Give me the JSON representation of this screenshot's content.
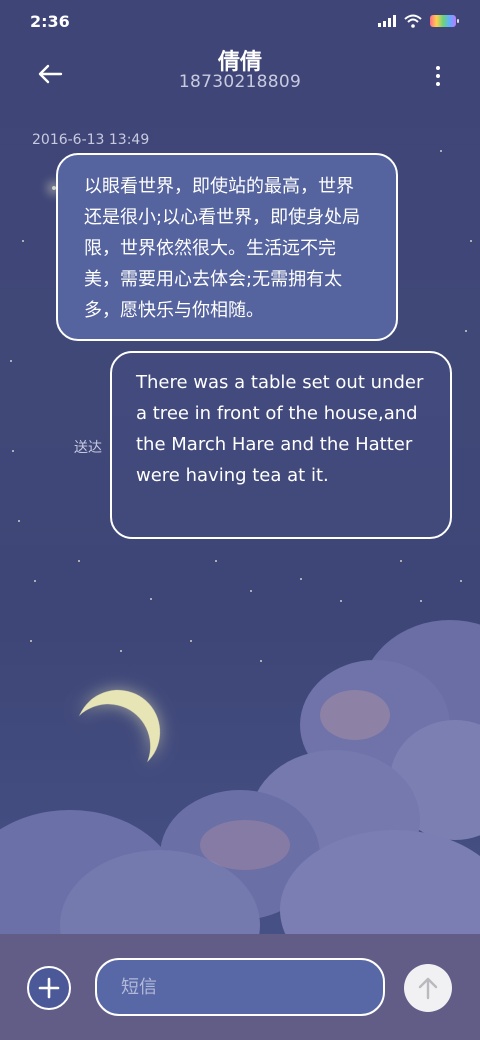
{
  "status_bar": {
    "time": "2:36",
    "icons": [
      "signal-icon",
      "wifi-icon",
      "battery-icon"
    ]
  },
  "header": {
    "contact_name": "倩倩",
    "contact_number": "18730218809",
    "back_icon": "back-arrow-icon",
    "more_icon": "more-vertical-icon"
  },
  "conversation": {
    "timestamp": "2016-6-13 13:49",
    "messages": [
      {
        "direction": "incoming",
        "text": "以眼看世界，即使站的最高，世界还是很小;以心看世界，即使身处局限，世界依然很大。生活远不完美，需要用心去体会;无需拥有太多，愿快乐与你相随。"
      },
      {
        "direction": "outgoing",
        "text": "There was a table set out under a tree in front of the house,and the March Hare and the Hatter were having tea at it.",
        "status": "送达"
      }
    ]
  },
  "composer": {
    "add_icon": "plus-icon",
    "input_value": "",
    "input_placeholder": "短信",
    "send_icon": "arrow-up-icon"
  },
  "colors": {
    "background": "#404878",
    "incoming_bubble": "#5665a0",
    "input_bar": "#625d86",
    "input_field": "#5868a6",
    "send_button": "#f1f1f3"
  }
}
